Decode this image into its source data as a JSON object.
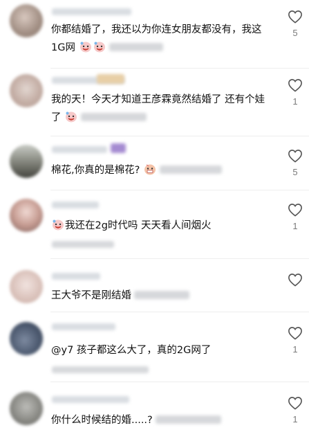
{
  "comments": [
    {
      "text_main": "你都结婚了，我还以为你连女朋友都没有，我这1G网",
      "like_count": "5",
      "avatar_color": "#b7a59a"
    },
    {
      "text_main": "我的天！今天才知道王彦霖竟然结婚了 还有个娃了",
      "like_count": "1",
      "avatar_color": "#c9b5ac"
    },
    {
      "text_main": "棉花,你真的是棉花?",
      "like_count": "5",
      "avatar_color": "#6b6b63"
    },
    {
      "text_main": "我还在2g时代吗 天天看人间烟火",
      "like_count": "1",
      "avatar_color": "#b89a92"
    },
    {
      "text_main": "王大爷不是刚结婚",
      "like_count": "",
      "avatar_color": "#dcc6c0"
    },
    {
      "text_main": "@y7 孩子都这么大了，真的2G网了",
      "like_count": "1",
      "avatar_color": "#56647a"
    },
    {
      "text_main": "你什么时候结的婚.....?",
      "like_count": "1",
      "avatar_color": "#8a8a86"
    }
  ]
}
